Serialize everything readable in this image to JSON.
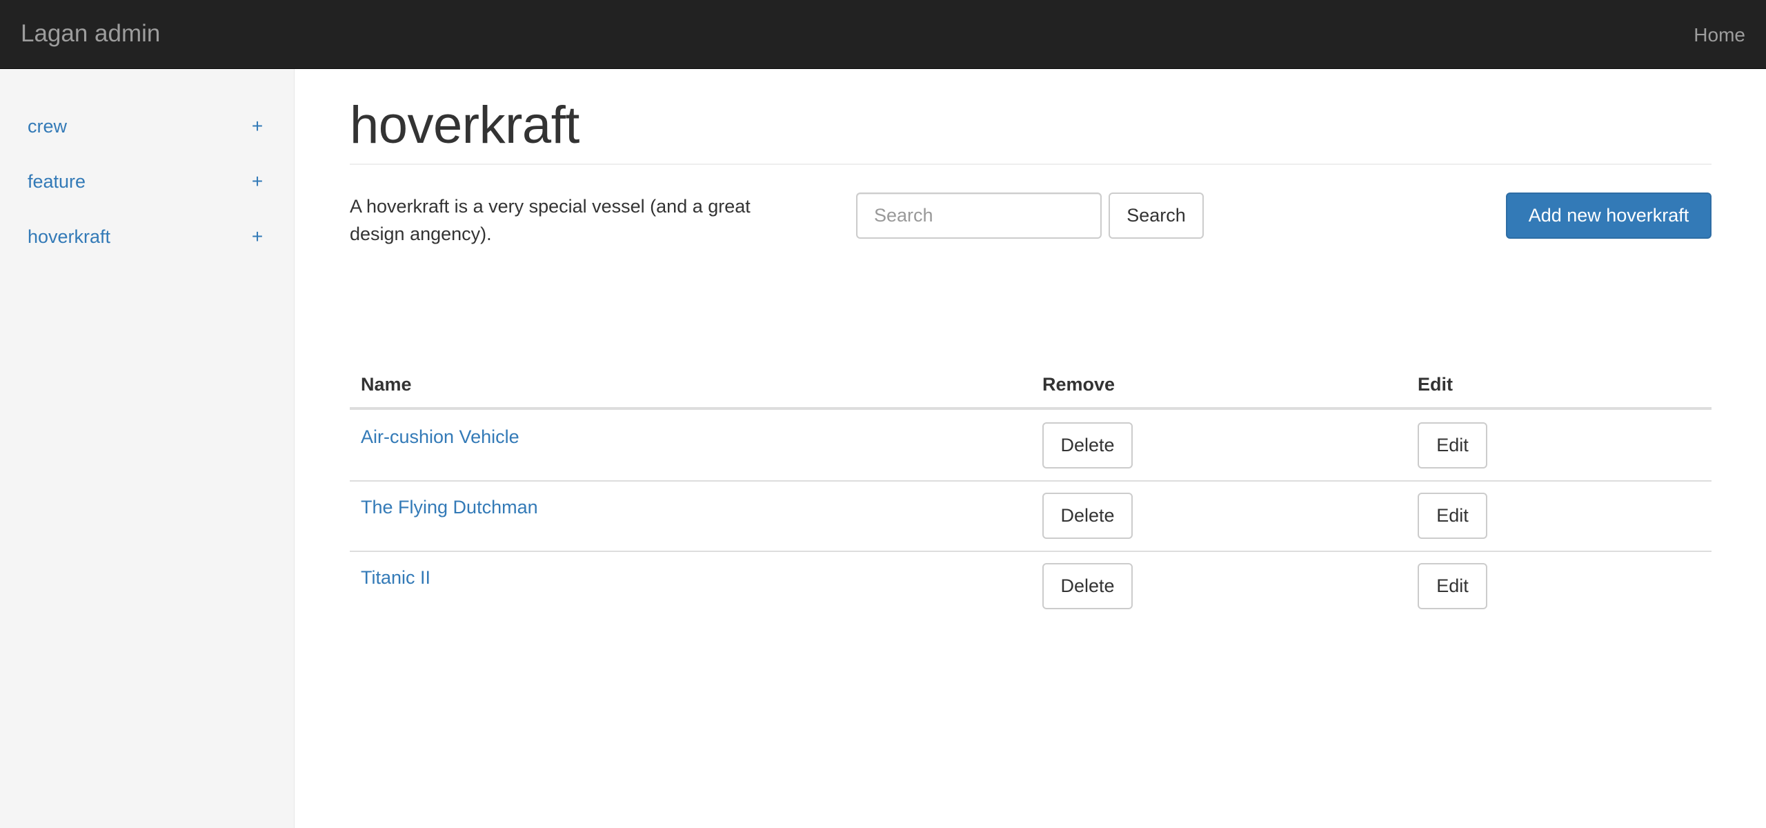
{
  "navbar": {
    "brand": "Lagan admin",
    "home": "Home"
  },
  "sidebar": {
    "items": [
      {
        "label": "crew",
        "add": "+"
      },
      {
        "label": "feature",
        "add": "+"
      },
      {
        "label": "hoverkraft",
        "add": "+"
      }
    ]
  },
  "main": {
    "title": "hoverkraft",
    "description": "A hoverkraft is a very special vessel (and a great design angency).",
    "search": {
      "placeholder": "Search",
      "value": "",
      "button": "Search"
    },
    "add_button": "Add new hoverkraft",
    "table": {
      "headers": {
        "name": "Name",
        "remove": "Remove",
        "edit": "Edit"
      },
      "rows": [
        {
          "name": "Air-cushion Vehicle",
          "delete": "Delete",
          "edit": "Edit"
        },
        {
          "name": "The Flying Dutchman",
          "delete": "Delete",
          "edit": "Edit"
        },
        {
          "name": "Titanic II",
          "delete": "Delete",
          "edit": "Edit"
        }
      ]
    }
  },
  "colors": {
    "navbar_bg": "#222222",
    "link": "#337ab7",
    "primary": "#337ab7",
    "sidebar_bg": "#f5f5f5"
  }
}
